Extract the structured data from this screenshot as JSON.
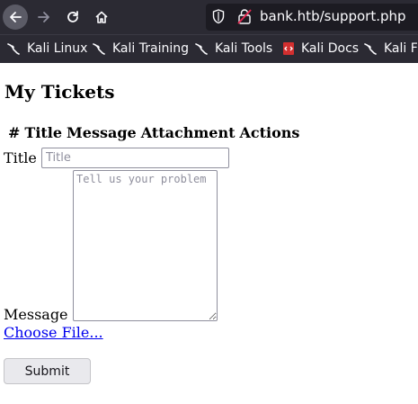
{
  "browser": {
    "url": "bank.htb/support.php",
    "bookmarks": [
      {
        "label": "Kali Linux",
        "icon": "kali-dragon-icon"
      },
      {
        "label": "Kali Training",
        "icon": "kali-dragon-icon"
      },
      {
        "label": "Kali Tools",
        "icon": "kali-dragon-icon"
      },
      {
        "label": "Kali Docs",
        "icon": "kali-docs-icon"
      },
      {
        "label": "Kali Fo",
        "icon": "kali-dragon-icon"
      }
    ]
  },
  "page": {
    "heading": "My Tickets",
    "table_columns": [
      "#",
      "Title",
      "Message",
      "Attachment",
      "Actions"
    ],
    "form": {
      "title_label": "Title",
      "title_placeholder": "Title",
      "title_value": "",
      "message_label": "Message",
      "message_placeholder": "Tell us your problem",
      "message_value": "",
      "file_link": "Choose File... ",
      "submit_label": "Submit"
    }
  },
  "colors": {
    "toolbar_bg": "#2b2a33",
    "url_bg": "#1c1b22",
    "link": "#0000ee",
    "docs_icon_red": "#d32f2f"
  }
}
